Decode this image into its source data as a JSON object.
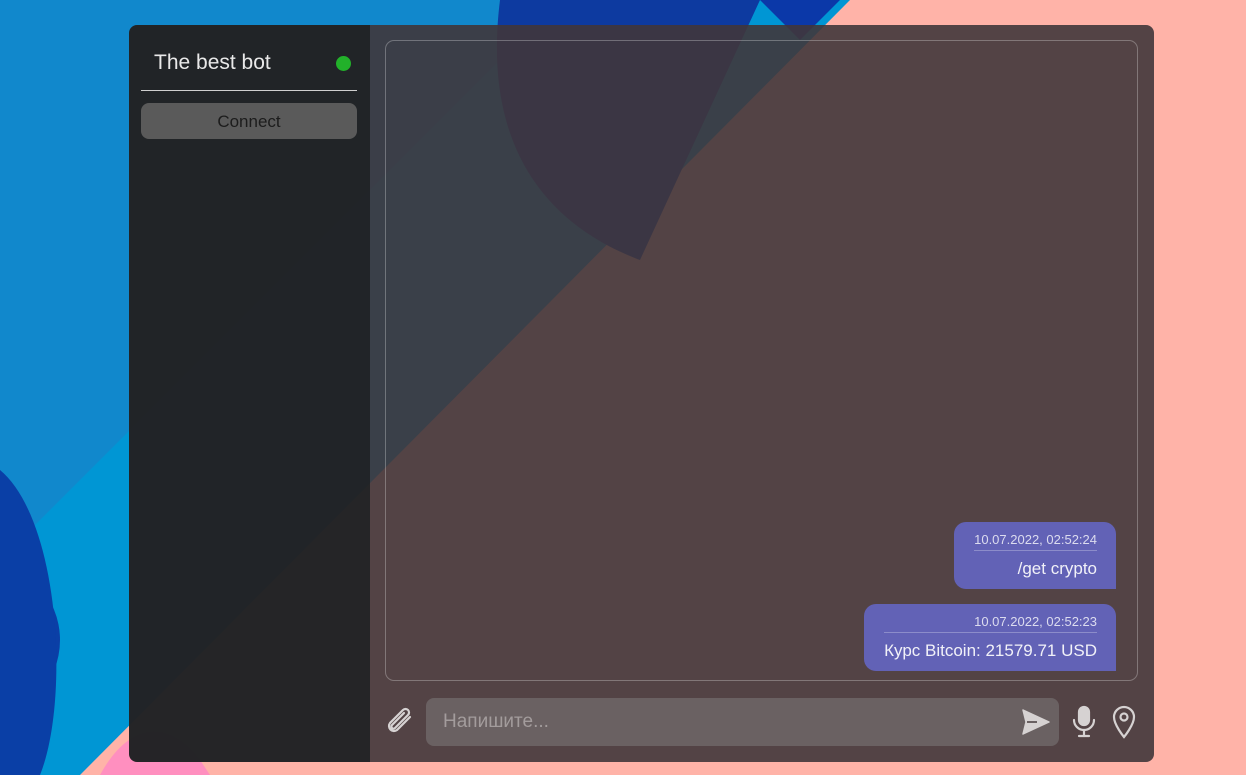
{
  "sidebar": {
    "bot_name": "The best bot",
    "status_color": "#22b12a",
    "connect_label": "Connect"
  },
  "chat": {
    "messages": [
      {
        "timestamp": "10.07.2022, 02:52:24",
        "text": "/get crypto"
      },
      {
        "timestamp": "10.07.2022, 02:52:23",
        "text": "Курс Bitcoin: 21579.71 USD"
      }
    ],
    "bubble_color": "#6262b6"
  },
  "composer": {
    "placeholder": "Напишите...",
    "value": ""
  },
  "icons": {
    "attach": "paperclip-icon",
    "send": "send-icon",
    "mic": "microphone-icon",
    "location": "location-pin-icon"
  }
}
